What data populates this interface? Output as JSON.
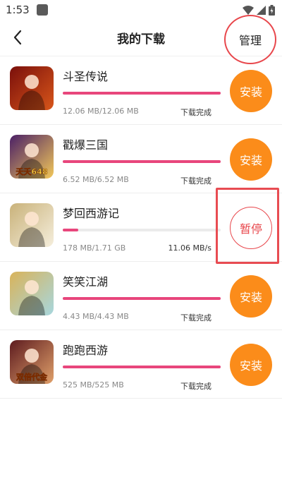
{
  "status_bar": {
    "time": "1:53"
  },
  "header": {
    "title": "我的下载",
    "manage_label": "管理"
  },
  "downloads": [
    {
      "name": "斗圣传说",
      "size": "12.06 MB/12.06 MB",
      "status": "下载完成",
      "action": "安装",
      "progress": 1.0,
      "icon_label": "",
      "colors": [
        "#7a0f0b",
        "#d8561a"
      ]
    },
    {
      "name": "戳爆三国",
      "size": "6.52 MB/6.52 MB",
      "status": "下载完成",
      "action": "安装",
      "progress": 1.0,
      "icon_label": "夭夭648",
      "colors": [
        "#4a1f66",
        "#f2c85a"
      ]
    },
    {
      "name": "梦回西游记",
      "size": "178 MB/1.71 GB",
      "status": "11.06 MB/s",
      "action": "暂停",
      "progress": 0.1,
      "icon_label": "",
      "colors": [
        "#c9b27a",
        "#f5eedc"
      ]
    },
    {
      "name": "笑笑江湖",
      "size": "4.43 MB/4.43 MB",
      "status": "下载完成",
      "action": "安装",
      "progress": 1.0,
      "icon_label": "",
      "colors": [
        "#d9b35a",
        "#a7d7de"
      ]
    },
    {
      "name": "跑跑西游",
      "size": "525 MB/525 MB",
      "status": "下载完成",
      "action": "安装",
      "progress": 1.0,
      "icon_label": "双倍代金",
      "colors": [
        "#5d1b1f",
        "#e0a06a"
      ]
    }
  ],
  "colors": {
    "accent_orange": "#fb8c1a",
    "progress_pink": "#e8467c",
    "highlight_red": "#e84c52"
  }
}
